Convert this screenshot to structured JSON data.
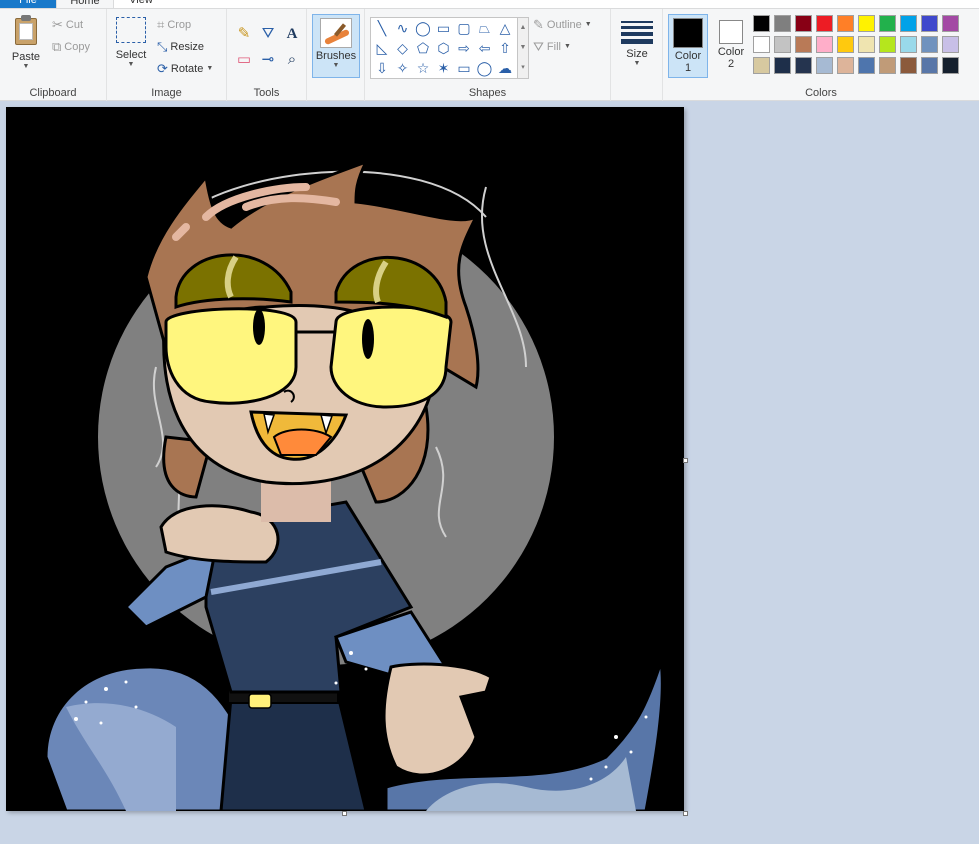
{
  "tabs": {
    "file": "File",
    "home": "Home",
    "view": "View"
  },
  "clipboard": {
    "group_label": "Clipboard",
    "paste": "Paste",
    "cut": "Cut",
    "copy": "Copy"
  },
  "image": {
    "group_label": "Image",
    "select": "Select",
    "crop": "Crop",
    "resize": "Resize",
    "rotate": "Rotate"
  },
  "tools": {
    "group_label": "Tools"
  },
  "brushes": {
    "label": "Brushes"
  },
  "shapes": {
    "group_label": "Shapes",
    "outline": "Outline",
    "fill": "Fill"
  },
  "size": {
    "label": "Size"
  },
  "colors": {
    "group_label": "Colors",
    "color1_label": "Color",
    "color1_num": "1",
    "color2_label": "Color",
    "color2_num": "2",
    "color1_value": "#000000",
    "color2_value": "#ffffff",
    "palette": [
      "#000000",
      "#7f7f7f",
      "#880015",
      "#ed1c24",
      "#ff7f27",
      "#fff200",
      "#22b14c",
      "#00a2e8",
      "#3f48cc",
      "#a349a4",
      "#ffffff",
      "#c3c3c3",
      "#b97a57",
      "#ffaec9",
      "#ffc90e",
      "#efe4b0",
      "#b5e61d",
      "#99d9ea",
      "#7092be",
      "#c8bfe7",
      "#d7c9a0",
      "#1e2f4a",
      "#25344f",
      "#a6bad3",
      "#ddb49a",
      "#4e75ad",
      "#c09b78",
      "#8b5a3c",
      "#5876a8",
      "#15202e"
    ]
  },
  "icons": {
    "cut": "✂",
    "copy": "⧉",
    "crop": "⌗",
    "resize": "⤡",
    "rotate": "⟳",
    "pencil": "✎",
    "fill": "⛛",
    "text": "A",
    "eraser": "▭",
    "picker": "⊸",
    "magnifier": "⌕"
  },
  "shape_glyphs": [
    "╲",
    "∿",
    "◯",
    "▭",
    "▢",
    "⏢",
    "△",
    "◺",
    "◇",
    "⬠",
    "⬡",
    "⇨",
    "⇦",
    "⇧",
    "⇩",
    "✧",
    "☆",
    "✶",
    "▭",
    "◯",
    "☁"
  ]
}
